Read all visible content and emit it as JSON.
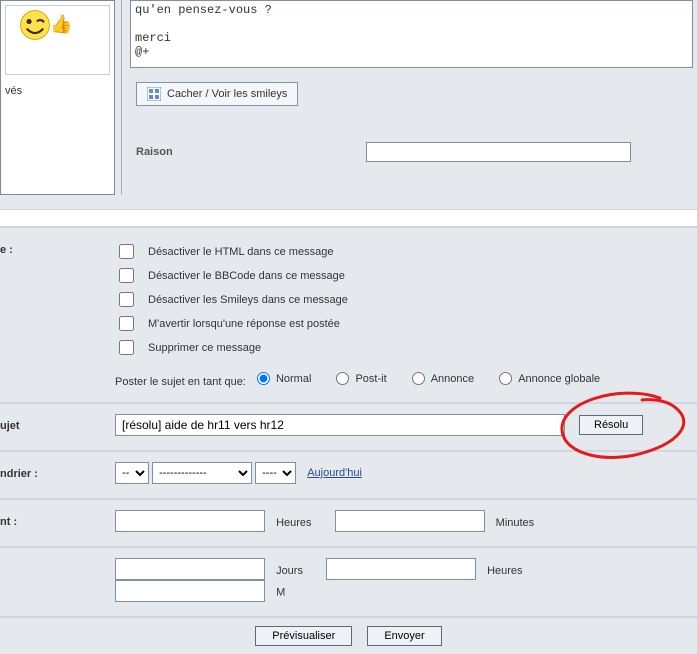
{
  "smiley_panel": {
    "vs_label": "vés"
  },
  "editor": {
    "body": "qu'en pensez-vous ?\n\nmerci\n@+",
    "smiley_toggle": "Cacher / Voir les smileys"
  },
  "raison": {
    "label": "Raison",
    "value": ""
  },
  "options": {
    "section_label": "e :",
    "disable_html": "Désactiver le HTML dans ce message",
    "disable_bbcode": "Désactiver le BBCode dans ce message",
    "disable_smileys": "Désactiver les Smileys dans ce message",
    "notify": "M'avertir lorsqu'une réponse est postée",
    "delete": "Supprimer ce message",
    "post_as_label": "Poster le sujet en tant que:",
    "post_as": {
      "normal": "Normal",
      "postit": "Post-it",
      "annonce": "Annonce",
      "global": "Annonce globale"
    }
  },
  "subject": {
    "label": "ujet",
    "value": "[résolu] aide de hr11 vers hr12",
    "resolu_btn": "Résolu"
  },
  "calendar": {
    "label": "ndrier :",
    "sel1": "--",
    "sel2": "-------------",
    "sel3": "----",
    "today_link": "Aujourd'hui"
  },
  "time_row": {
    "label": "nt :",
    "hours": "Heures",
    "minutes": "Minutes",
    "hours_val": "",
    "minutes_val": ""
  },
  "duration_row": {
    "jours": "Jours",
    "heures": "Heures",
    "jours_val": "",
    "heures_val": "",
    "m_label": "M"
  },
  "actions": {
    "preview": "Prévisualiser",
    "submit": "Envoyer"
  }
}
